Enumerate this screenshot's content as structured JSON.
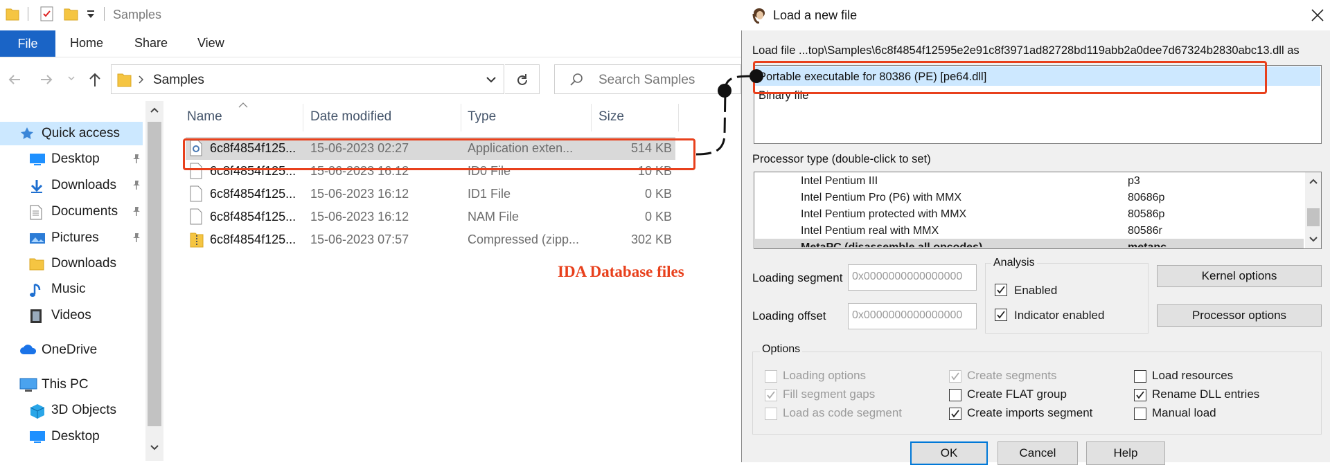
{
  "explorer": {
    "title": "Samples",
    "ribbon": {
      "file": "File",
      "home": "Home",
      "share": "Share",
      "view": "View"
    },
    "address": {
      "crumb": "Samples"
    },
    "search": {
      "placeholder": "Search Samples"
    },
    "nav": [
      {
        "label": "Quick access",
        "icon": "star-icon",
        "pinned": false
      },
      {
        "label": "Desktop",
        "icon": "desktop-icon",
        "pinned": true
      },
      {
        "label": "Downloads",
        "icon": "download-arrow-icon",
        "pinned": true
      },
      {
        "label": "Documents",
        "icon": "document-icon",
        "pinned": true
      },
      {
        "label": "Pictures",
        "icon": "pictures-icon",
        "pinned": true
      },
      {
        "label": "Downloads",
        "icon": "folder-icon",
        "pinned": false
      },
      {
        "label": "Music",
        "icon": "music-note-icon",
        "pinned": false
      },
      {
        "label": "Videos",
        "icon": "film-icon",
        "pinned": false
      },
      {
        "label": "OneDrive",
        "icon": "cloud-icon",
        "pinned": false
      },
      {
        "label": "This PC",
        "icon": "computer-icon",
        "pinned": false
      },
      {
        "label": "3D Objects",
        "icon": "cube-icon",
        "pinned": false
      },
      {
        "label": "Desktop",
        "icon": "desktop-icon",
        "pinned": false
      }
    ],
    "columns": {
      "name": "Name",
      "date": "Date modified",
      "type": "Type",
      "size": "Size"
    },
    "files": [
      {
        "name": "6c8f4854f125...",
        "date": "15-06-2023 02:27",
        "type": "Application exten...",
        "size": "514 KB",
        "icon": "dll-file-icon",
        "selected": true
      },
      {
        "name": "6c8f4854f125...",
        "date": "15-06-2023 16:12",
        "type": "ID0 File",
        "size": "10 KB",
        "icon": "blank-file-icon",
        "selected": false
      },
      {
        "name": "6c8f4854f125...",
        "date": "15-06-2023 16:12",
        "type": "ID1 File",
        "size": "0 KB",
        "icon": "blank-file-icon",
        "selected": false
      },
      {
        "name": "6c8f4854f125...",
        "date": "15-06-2023 16:12",
        "type": "NAM File",
        "size": "0 KB",
        "icon": "blank-file-icon",
        "selected": false
      },
      {
        "name": "6c8f4854f125...",
        "date": "15-06-2023 07:57",
        "type": "Compressed (zipp...",
        "size": "302 KB",
        "icon": "zip-folder-icon",
        "selected": false
      }
    ]
  },
  "annotation": {
    "text": "IDA Database files",
    "color": "#e8401c"
  },
  "dialog": {
    "title": "Load a new file",
    "load_file_label": "Load file ...top\\Samples\\6c8f4854f12595e2e91c8f3971ad82728bd119abb2a0dee7d67324b2830abc13.dll as",
    "loaders": [
      "Portable executable for 80386 (PE) [pe64.dll]",
      "Binary file"
    ],
    "processor_label": "Processor type (double-click to set)",
    "processors": [
      {
        "name": "Intel Pentium III",
        "code": "p3"
      },
      {
        "name": "Intel Pentium Pro (P6) with MMX",
        "code": "80686p"
      },
      {
        "name": "Intel Pentium protected with MMX",
        "code": "80586p"
      },
      {
        "name": "Intel Pentium real with MMX",
        "code": "80586r"
      },
      {
        "name": "MetaPC (disassemble all opcodes)",
        "code": "metapc"
      }
    ],
    "loading_segment_label": "Loading segment",
    "loading_segment_value": "0x0000000000000000",
    "loading_offset_label": "Loading offset",
    "loading_offset_value": "0x0000000000000000",
    "analysis": {
      "label": "Analysis",
      "enabled": "Enabled",
      "indicator": "Indicator enabled"
    },
    "kernel_options": "Kernel options",
    "processor_options": "Processor options",
    "options": {
      "label": "Options",
      "items": [
        {
          "label": "Loading options",
          "checked": false,
          "disabled": true
        },
        {
          "label": "Fill segment gaps",
          "checked": true,
          "disabled": true
        },
        {
          "label": "Load as code segment",
          "checked": false,
          "disabled": true
        },
        {
          "label": "Create segments",
          "checked": true,
          "disabled": true
        },
        {
          "label": "Create FLAT group",
          "checked": false,
          "disabled": false
        },
        {
          "label": "Create imports segment",
          "checked": true,
          "disabled": false
        },
        {
          "label": "Load resources",
          "checked": false,
          "disabled": false
        },
        {
          "label": "Rename DLL entries",
          "checked": true,
          "disabled": false
        },
        {
          "label": "Manual load",
          "checked": false,
          "disabled": false
        }
      ]
    },
    "buttons": {
      "ok": "OK",
      "cancel": "Cancel",
      "help": "Help"
    }
  }
}
